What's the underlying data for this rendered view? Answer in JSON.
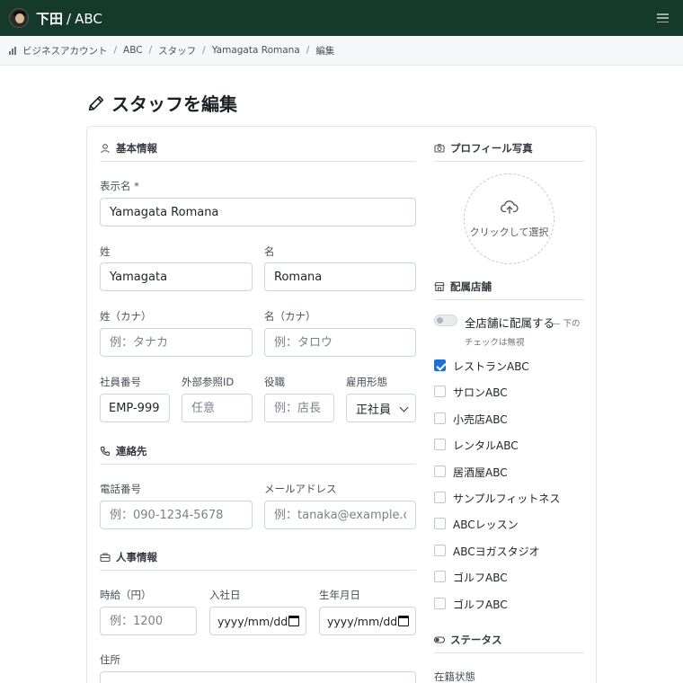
{
  "header": {
    "owner": "下田",
    "separator": "/",
    "account": "ABC"
  },
  "breadcrumb": [
    "ビジネスアカウント",
    "ABC",
    "スタッフ",
    "Yamagata Romana",
    "編集"
  ],
  "page": {
    "title": "スタッフを編集"
  },
  "sections": {
    "basic": "基本情報",
    "contact": "連絡先",
    "hr": "人事情報",
    "photo": "プロフィール写真",
    "stores": "配属店舗",
    "status": "ステータス"
  },
  "fields": {
    "display_name": {
      "label": "表示名 *",
      "value": "Yamagata Romana"
    },
    "last_name": {
      "label": "姓",
      "value": "Yamagata"
    },
    "first_name": {
      "label": "名",
      "value": "Romana"
    },
    "last_kana": {
      "label": "姓（カナ）",
      "placeholder": "例：タナカ"
    },
    "first_kana": {
      "label": "名（カナ）",
      "placeholder": "例：タロウ"
    },
    "employee_no": {
      "label": "社員番号",
      "value": "EMP-999"
    },
    "external_id": {
      "label": "外部参照ID",
      "placeholder": "任意"
    },
    "position": {
      "label": "役職",
      "placeholder": "例：店長"
    },
    "employment_type": {
      "label": "雇用形態",
      "value": "正社員"
    },
    "phone": {
      "label": "電話番号",
      "placeholder": "例：090-1234-5678"
    },
    "email": {
      "label": "メールアドレス",
      "placeholder": "例：tanaka@example.com"
    },
    "hourly_wage": {
      "label": "時給（円）",
      "placeholder": "例：1200"
    },
    "hire_date": {
      "label": "入社日",
      "placeholder": "yyyy/mm/dd"
    },
    "birth_date": {
      "label": "生年月日",
      "placeholder": "yyyy/mm/dd"
    },
    "address": {
      "label": "住所"
    },
    "employment_status": {
      "label": "在籍状態"
    }
  },
  "photo": {
    "upload_text": "クリックして選択"
  },
  "stores": {
    "all_toggle_label": "全店舗に配属する",
    "all_toggle_hint_1": "— 下の",
    "all_toggle_hint_2": "チェックは無視",
    "all_toggle_on": false,
    "items": [
      {
        "name": "レストランABC",
        "checked": true
      },
      {
        "name": "サロンABC",
        "checked": false
      },
      {
        "name": "小売店ABC",
        "checked": false
      },
      {
        "name": "レンタルABC",
        "checked": false
      },
      {
        "name": "居酒屋ABC",
        "checked": false
      },
      {
        "name": "サンプルフィットネス",
        "checked": false
      },
      {
        "name": "ABCレッスン",
        "checked": false
      },
      {
        "name": "ABCヨガスタジオ",
        "checked": false
      },
      {
        "name": "ゴルフABC",
        "checked": false
      },
      {
        "name": "ゴルフABC",
        "checked": false
      }
    ]
  },
  "colors": {
    "header_bg": "#153a2b",
    "checkbox_accent": "#1e6fd9"
  }
}
